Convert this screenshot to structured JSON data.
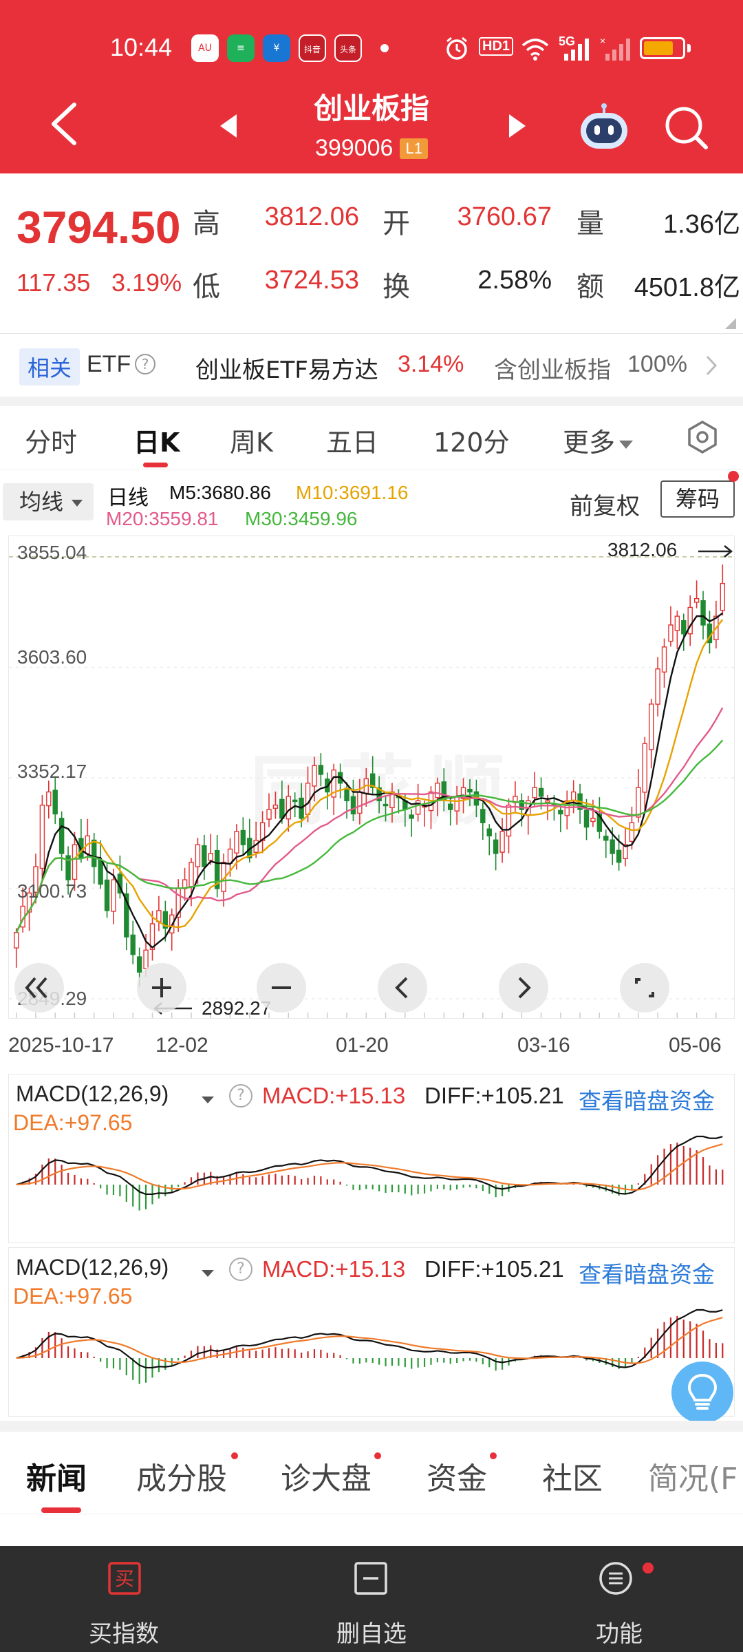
{
  "status_bar": {
    "time": "10:44",
    "apps": [
      {
        "icon": "au-app-icon",
        "text": "AU"
      },
      {
        "icon": "chat-app-icon",
        "text": "≡"
      },
      {
        "icon": "bank-app-icon",
        "text": "¥"
      },
      {
        "icon": "shopping-app-icon",
        "text": "抖音"
      },
      {
        "icon": "news-app-icon",
        "text": "头条"
      }
    ],
    "hd_badge": "HD1",
    "network": "5G",
    "colors": {
      "background": "#e8303a",
      "battery": "#f5a800"
    }
  },
  "header": {
    "title": "创业板指",
    "code": "399006",
    "level": "L1",
    "icons": [
      "back-arrow-icon",
      "prev-triangle-icon",
      "next-triangle-icon",
      "robot-assistant-icon",
      "search-icon"
    ]
  },
  "quote": {
    "price": "3794.50",
    "change": "117.35",
    "change_pct": "3.19%",
    "high_label": "高",
    "high": "3812.06",
    "open_label": "开",
    "open": "3760.67",
    "vol_label": "量",
    "volume": "1.36亿",
    "low_label": "低",
    "low": "3724.53",
    "turnover_label": "换",
    "turnover": "2.58%",
    "amount_label": "额",
    "amount": "4501.8亿"
  },
  "etf": {
    "tag": "相关",
    "label": "ETF",
    "help": "?",
    "name": "创业板ETF易方达",
    "pct": "3.14%",
    "weight_label": "含创业板指",
    "weight": "100%"
  },
  "period_tabs": {
    "items": [
      "分时",
      "日K",
      "周K",
      "五日",
      "120分",
      "更多"
    ],
    "active": "日K"
  },
  "ma_bar": {
    "select": "均线",
    "kind": "日线",
    "m5": "M5:3680.86",
    "m10": "M10:3691.16",
    "m20": "M20:3559.81",
    "m30": "M30:3459.96",
    "adjust": "前复权",
    "chips": "筹码",
    "colors": {
      "m5": "#111111",
      "m10": "#e6a300",
      "m20": "#e25a8a",
      "m30": "#45b83c"
    }
  },
  "chart": {
    "watermark": "同花顺",
    "high_marker": "3812.06",
    "low_marker": "2892.27",
    "price_ticks": [
      "3855.04",
      "3603.60",
      "3352.17",
      "3100.73",
      "2849.29"
    ],
    "dates": [
      "2025-10-17",
      "12-02",
      "01-20",
      "03-16",
      "05-06"
    ],
    "controls": [
      "rewind-icon",
      "zoom-in-icon",
      "zoom-out-icon",
      "pan-left-icon",
      "pan-right-icon",
      "fullscreen-icon"
    ]
  },
  "chart_data": {
    "type": "candlestick",
    "x_start": "2025-10-17",
    "x_end": "05-06",
    "ylim": [
      2849.29,
      3855.04
    ],
    "x_ticks": [
      "2025-10-17",
      "12-02",
      "01-20",
      "03-16",
      "05-06"
    ],
    "y_ticks": [
      3855.04,
      3603.6,
      3352.17,
      3100.73,
      2849.29
    ],
    "closes": [
      3000,
      3060,
      3090,
      3150,
      3290,
      3320,
      3270,
      3180,
      3120,
      3200,
      3170,
      3220,
      3150,
      3110,
      3050,
      3120,
      3090,
      2990,
      2950,
      2910,
      2960,
      3020,
      3050,
      3010,
      3040,
      3100,
      3120,
      3160,
      3200,
      3150,
      3180,
      3100,
      3160,
      3190,
      3230,
      3200,
      3170,
      3210,
      3250,
      3280,
      3290,
      3260,
      3310,
      3300,
      3260,
      3340,
      3380,
      3360,
      3320,
      3370,
      3340,
      3300,
      3270,
      3320,
      3350,
      3330,
      3300,
      3290,
      3320,
      3310,
      3280,
      3260,
      3300,
      3290,
      3320,
      3340,
      3300,
      3280,
      3310,
      3330,
      3320,
      3290,
      3250,
      3220,
      3180,
      3230,
      3290,
      3310,
      3280,
      3300,
      3330,
      3310,
      3300,
      3290,
      3270,
      3300,
      3320,
      3280,
      3240,
      3260,
      3230,
      3210,
      3180,
      3160,
      3200,
      3250,
      3330,
      3430,
      3520,
      3600,
      3650,
      3700,
      3720,
      3680,
      3740,
      3760,
      3700,
      3660,
      3720,
      3794.5
    ],
    "high": 3812.06,
    "low": 2892.27,
    "series": [
      {
        "name": "M5",
        "last": 3680.86
      },
      {
        "name": "M10",
        "last": 3691.16
      },
      {
        "name": "M20",
        "last": 3559.81
      },
      {
        "name": "M30",
        "last": 3459.96
      }
    ],
    "grid": true,
    "legend": "top-left"
  },
  "macd_panels": [
    {
      "select": "MACD(12,26,9)",
      "help": "?",
      "macd": "MACD:+15.13",
      "diff": "DIFF:+105.21",
      "dea": "DEA:+97.65",
      "link": "查看暗盘资金"
    },
    {
      "select": "MACD(12,26,9)",
      "help": "?",
      "macd": "MACD:+15.13",
      "diff": "DIFF:+105.21",
      "dea": "DEA:+97.65",
      "link": "查看暗盘资金"
    }
  ],
  "info_tabs": {
    "items": [
      "新闻",
      "成分股",
      "诊大盘",
      "资金",
      "社区",
      "简况(F"
    ],
    "active": "新闻"
  },
  "action_bar": {
    "buy": "买指数",
    "buy_icon_text": "买",
    "remove": "删自选",
    "func": "功能"
  }
}
